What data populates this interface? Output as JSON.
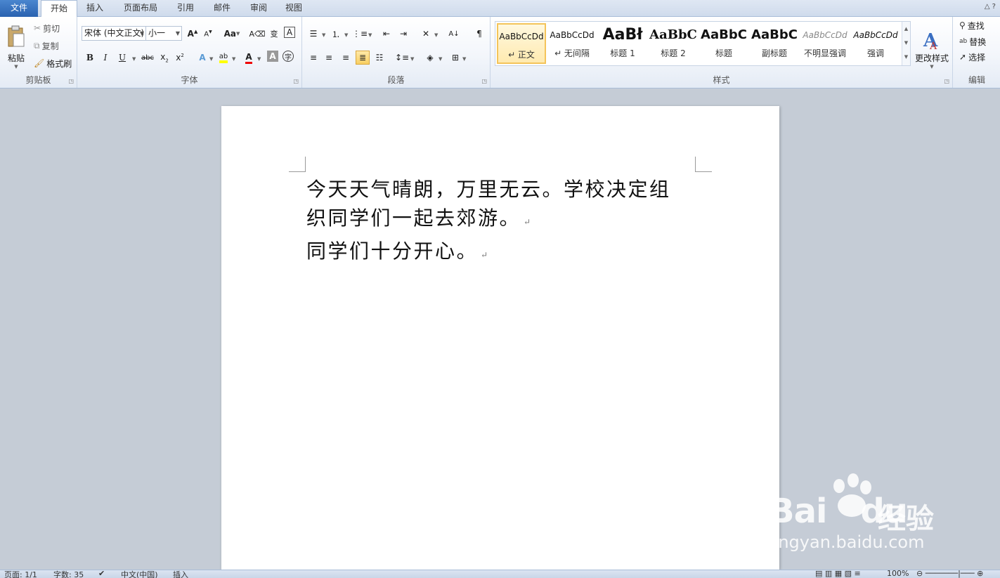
{
  "tabs": [
    {
      "label": "文件",
      "kind": "file"
    },
    {
      "label": "开始",
      "kind": "active"
    },
    {
      "label": "插入"
    },
    {
      "label": "页面布局"
    },
    {
      "label": "引用"
    },
    {
      "label": "邮件"
    },
    {
      "label": "审阅"
    },
    {
      "label": "视图"
    }
  ],
  "clipboard": {
    "paste": "粘贴",
    "cut": "剪切",
    "copy": "复制",
    "format_painter": "格式刷",
    "group_label": "剪贴板"
  },
  "font": {
    "font_name": "宋体 (中文正文)",
    "font_size": "小一",
    "bold": "B",
    "italic": "I",
    "underline": "U",
    "strikethrough": "abc",
    "case": "Aa",
    "group_label": "字体"
  },
  "paragraph": {
    "group_label": "段落"
  },
  "styles": {
    "items": [
      {
        "sample": "AaBbCcDd",
        "name": "↵ 正文"
      },
      {
        "sample": "AaBbCcDd",
        "name": "↵ 无间隔"
      },
      {
        "sample": "AaBł",
        "name": "标题 1"
      },
      {
        "sample": "AaBbC",
        "name": "标题 2"
      },
      {
        "sample": "AaBbC",
        "name": "标题"
      },
      {
        "sample": "AaBbC",
        "name": "副标题"
      },
      {
        "sample": "AaBbCcDd",
        "name": "不明显强调"
      },
      {
        "sample": "AaBbCcDd",
        "name": "强调"
      }
    ],
    "change_styles": "更改样式",
    "group_label": "样式"
  },
  "editing": {
    "find": "查找",
    "replace": "替换",
    "select": "选择",
    "group_label": "编辑"
  },
  "document": {
    "line1": "今天天气晴朗，万里无云。学校决定组",
    "line2": "织同学们一起去郊游。",
    "line3": "同学们十分开心。",
    "para_mark": "↵"
  },
  "watermark": {
    "logo": "Bai",
    "logo_suffix": "du",
    "cn": "经验",
    "url": "jingyan.baidu.com"
  },
  "status": {
    "page": "页面: 1/1",
    "words": "字数: 35",
    "language": "中文(中国)",
    "mode": "插入",
    "zoom": "100%"
  }
}
